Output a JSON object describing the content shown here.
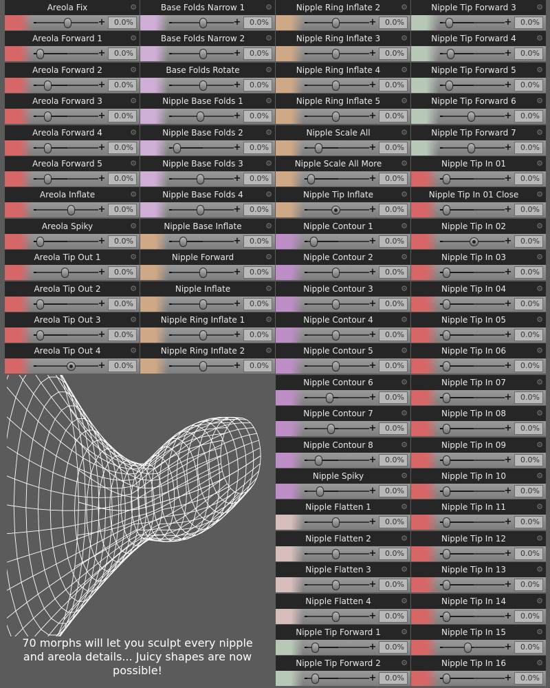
{
  "colors": {
    "red": "#d76767",
    "lilac": "#cfaed6",
    "tan": "#cfa886",
    "purple": "#be8ec7",
    "pink": "#d7bebb",
    "green": "#b7c8b6"
  },
  "columns": [
    {
      "items": [
        {
          "label": "Areola Fix",
          "value": "0.0%",
          "color": "red",
          "knob": 0.5,
          "style": "pill"
        },
        {
          "label": "Areola Forward 1",
          "value": "0.0%",
          "color": "red",
          "knob": 0.06,
          "style": "pill"
        },
        {
          "label": "Areola Forward 2",
          "value": "0.0%",
          "color": "red",
          "knob": 0.18,
          "style": "pill"
        },
        {
          "label": "Areola Forward 3",
          "value": "0.0%",
          "color": "red",
          "knob": 0.18,
          "style": "pill"
        },
        {
          "label": "Areola Forward 4",
          "value": "0.0%",
          "color": "red",
          "knob": 0.18,
          "style": "pill"
        },
        {
          "label": "Areola Forward 5",
          "value": "0.0%",
          "color": "red",
          "knob": 0.18,
          "style": "pill"
        },
        {
          "label": "Areola Inflate",
          "value": "0.0%",
          "color": "red",
          "knob": 0.55,
          "style": "pill"
        },
        {
          "label": "Areola Spiky",
          "value": "0.0%",
          "color": "red",
          "knob": 0.06,
          "style": "pill"
        },
        {
          "label": "Areola Tip Out 1",
          "value": "0.0%",
          "color": "red",
          "knob": 0.45,
          "style": "pill"
        },
        {
          "label": "Areola Tip Out 2",
          "value": "0.0%",
          "color": "red",
          "knob": 0.06,
          "style": "pill"
        },
        {
          "label": "Areola Tip Out 3",
          "value": "0.0%",
          "color": "red",
          "knob": 0.06,
          "style": "pill"
        },
        {
          "label": "Areola Tip Out 4",
          "value": "0.0%",
          "color": "red",
          "knob": 0.55,
          "style": "dot"
        }
      ]
    },
    {
      "items": [
        {
          "label": "Base Folds Narrow 1",
          "value": "0.0%",
          "color": "lilac",
          "knob": 0.5,
          "style": "pill"
        },
        {
          "label": "Base Folds Narrow 2",
          "value": "0.0%",
          "color": "lilac",
          "knob": 0.5,
          "style": "pill"
        },
        {
          "label": "Base Folds Rotate",
          "value": "0.0%",
          "color": "lilac",
          "knob": 0.5,
          "style": "pill"
        },
        {
          "label": "Nipple Base Folds 1",
          "value": "0.0%",
          "color": "lilac",
          "knob": 0.45,
          "style": "pill"
        },
        {
          "label": "Nipple Base Folds 2",
          "value": "0.0%",
          "color": "lilac",
          "knob": 0.08,
          "style": "pill"
        },
        {
          "label": "Nipple Base Folds 3",
          "value": "0.0%",
          "color": "lilac",
          "knob": 0.45,
          "style": "pill"
        },
        {
          "label": "Nipple Base Folds 4",
          "value": "0.0%",
          "color": "lilac",
          "knob": 0.45,
          "style": "pill"
        },
        {
          "label": "Nipple Base Inflate",
          "value": "0.0%",
          "color": "tan",
          "knob": 0.18,
          "style": "pill"
        },
        {
          "label": "Nipple Forward",
          "value": "0.0%",
          "color": "tan",
          "knob": 0.5,
          "style": "pill"
        },
        {
          "label": "Nipple Inflate",
          "value": "0.0%",
          "color": "tan",
          "knob": 0.5,
          "style": "pill"
        },
        {
          "label": "Nipple Ring Inflate 1",
          "value": "0.0%",
          "color": "tan",
          "knob": 0.5,
          "style": "pill"
        },
        {
          "label": "Nipple Ring Inflate 2",
          "value": "0.0%",
          "color": "tan",
          "knob": 0.5,
          "style": "pill"
        }
      ]
    },
    {
      "items": [
        {
          "label": "Nipple Ring Inflate 2",
          "value": "0.0%",
          "color": "tan",
          "knob": 0.45,
          "style": "pill"
        },
        {
          "label": "Nipple Ring Inflate 3",
          "value": "0.0%",
          "color": "tan",
          "knob": 0.45,
          "style": "pill"
        },
        {
          "label": "Nipple Ring Inflate 4",
          "value": "0.0%",
          "color": "tan",
          "knob": 0.45,
          "style": "pill"
        },
        {
          "label": "Nipple Ring Inflate 5",
          "value": "0.0%",
          "color": "tan",
          "knob": 0.45,
          "style": "pill"
        },
        {
          "label": "Nipple Scale All",
          "value": "0.0%",
          "color": "tan",
          "knob": 0.18,
          "style": "pill"
        },
        {
          "label": "Nipple Scale All More",
          "value": "0.0%",
          "color": "tan",
          "knob": 0.06,
          "style": "pill"
        },
        {
          "label": "Nipple Tip Inflate",
          "value": "0.0%",
          "color": "tan",
          "knob": 0.45,
          "style": "dot"
        },
        {
          "label": "Nipple Contour 1",
          "value": "0.0%",
          "color": "purple",
          "knob": 0.1,
          "style": "pill"
        },
        {
          "label": "Nipple Contour 2",
          "value": "0.0%",
          "color": "purple",
          "knob": 0.45,
          "style": "pill"
        },
        {
          "label": "Nipple Contour 3",
          "value": "0.0%",
          "color": "purple",
          "knob": 0.45,
          "style": "pill"
        },
        {
          "label": "Nipple Contour 4",
          "value": "0.0%",
          "color": "purple",
          "knob": 0.45,
          "style": "pill"
        },
        {
          "label": "Nipple Contour 5",
          "value": "0.0%",
          "color": "purple",
          "knob": 0.45,
          "style": "pill"
        },
        {
          "label": "Nipple Contour 6",
          "value": "0.0%",
          "color": "purple",
          "knob": 0.35,
          "style": "pill"
        },
        {
          "label": "Nipple Contour 7",
          "value": "0.0%",
          "color": "purple",
          "knob": 0.38,
          "style": "pill"
        },
        {
          "label": "Nipple Contour 8",
          "value": "0.0%",
          "color": "purple",
          "knob": 0.18,
          "style": "pill"
        },
        {
          "label": "Nipple Spiky",
          "value": "0.0%",
          "color": "purple",
          "knob": 0.2,
          "style": "pill"
        },
        {
          "label": "Nipple Flatten 1",
          "value": "0.0%",
          "color": "pink",
          "knob": 0.45,
          "style": "pill"
        },
        {
          "label": "Nipple Flatten 2",
          "value": "0.0%",
          "color": "pink",
          "knob": 0.45,
          "style": "pill"
        },
        {
          "label": "Nipple Flatten 3",
          "value": "0.0%",
          "color": "pink",
          "knob": 0.45,
          "style": "pill"
        },
        {
          "label": "Nipple Flatten 4",
          "value": "0.0%",
          "color": "pink",
          "knob": 0.45,
          "style": "pill"
        },
        {
          "label": "Nipple Tip Forward 1",
          "value": "0.0%",
          "color": "green",
          "knob": 0.12,
          "style": "pill"
        },
        {
          "label": "Nipple Tip Forward 2",
          "value": "0.0%",
          "color": "green",
          "knob": 0.12,
          "style": "pill"
        }
      ]
    },
    {
      "items": [
        {
          "label": "Nipple Tip Forward 3",
          "value": "0.0%",
          "color": "green",
          "knob": 0.1,
          "style": "pill"
        },
        {
          "label": "Nipple Tip Forward 4",
          "value": "0.0%",
          "color": "green",
          "knob": 0.12,
          "style": "pill"
        },
        {
          "label": "Nipple Tip Forward 5",
          "value": "0.0%",
          "color": "green",
          "knob": 0.1,
          "style": "pill"
        },
        {
          "label": "Nipple Tip Forward 6",
          "value": "0.0%",
          "color": "green",
          "knob": 0.45,
          "style": "pill"
        },
        {
          "label": "Nipple Tip Forward 7",
          "value": "0.0%",
          "color": "green",
          "knob": 0.45,
          "style": "pill"
        },
        {
          "label": "Nipple Tip In 01",
          "value": "0.0%",
          "color": "red",
          "knob": 0.06,
          "style": "pill"
        },
        {
          "label": "Nipple Tip In 01 Close",
          "value": "0.0%",
          "color": "red",
          "knob": 0.06,
          "style": "pill"
        },
        {
          "label": "Nipple Tip In 02",
          "value": "0.0%",
          "color": "red",
          "knob": 0.5,
          "style": "dot"
        },
        {
          "label": "Nipple Tip In 03",
          "value": "0.0%",
          "color": "red",
          "knob": 0.06,
          "style": "pill"
        },
        {
          "label": "Nipple Tip In 04",
          "value": "0.0%",
          "color": "red",
          "knob": 0.06,
          "style": "pill"
        },
        {
          "label": "Nipple Tip In 05",
          "value": "0.0%",
          "color": "red",
          "knob": 0.06,
          "style": "pill"
        },
        {
          "label": "Nipple Tip In 06",
          "value": "0.0%",
          "color": "red",
          "knob": 0.06,
          "style": "pill"
        },
        {
          "label": "Nipple Tip In 07",
          "value": "0.0%",
          "color": "red",
          "knob": 0.06,
          "style": "pill"
        },
        {
          "label": "Nipple Tip In 08",
          "value": "0.0%",
          "color": "red",
          "knob": 0.06,
          "style": "pill"
        },
        {
          "label": "Nipple Tip In 09",
          "value": "0.0%",
          "color": "red",
          "knob": 0.06,
          "style": "pill"
        },
        {
          "label": "Nipple Tip In 10",
          "value": "0.0%",
          "color": "red",
          "knob": 0.06,
          "style": "pill"
        },
        {
          "label": "Nipple Tip In 11",
          "value": "0.0%",
          "color": "red",
          "knob": 0.06,
          "style": "pill"
        },
        {
          "label": "Nipple Tip In 12",
          "value": "0.0%",
          "color": "red",
          "knob": 0.06,
          "style": "pill"
        },
        {
          "label": "Nipple Tip In 13",
          "value": "0.0%",
          "color": "red",
          "knob": 0.06,
          "style": "pill"
        },
        {
          "label": "Nipple Tip In 14",
          "value": "0.0%",
          "color": "red",
          "knob": 0.06,
          "style": "pill"
        },
        {
          "label": "Nipple Tip In 15",
          "value": "0.0%",
          "color": "red",
          "knob": 0.4,
          "style": "pill"
        },
        {
          "label": "Nipple Tip In 16",
          "value": "0.0%",
          "color": "red",
          "knob": 0.06,
          "style": "pill"
        }
      ]
    }
  ],
  "caption": "70 morphs will let you sculpt every nipple and areola details... Juicy shapes are now possible!"
}
